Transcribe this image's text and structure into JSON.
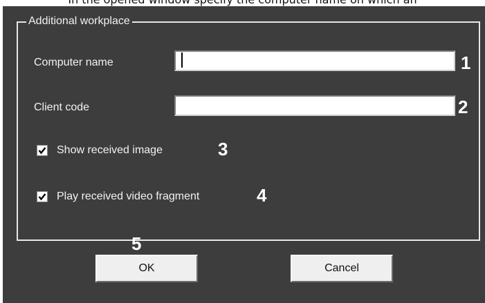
{
  "caption": "In the opened window specify the computer name on which an",
  "dialog": {
    "group_title": "Additional workplace",
    "fields": {
      "computer_name": {
        "label": "Computer name",
        "value": "",
        "marker": "1"
      },
      "client_code": {
        "label": "Client code",
        "value": "",
        "marker": "2"
      }
    },
    "checkboxes": {
      "show_image": {
        "label": "Show received image",
        "checked": true,
        "marker": "3"
      },
      "play_video": {
        "label": "Play received video fragment",
        "checked": true,
        "marker": "4"
      }
    },
    "buttons": {
      "ok": {
        "label": "OK",
        "marker": "5"
      },
      "cancel": {
        "label": "Cancel"
      }
    }
  },
  "colors": {
    "dialog_background": "#3d3d3d",
    "label_text": "#f2f2f2",
    "marker_text": "#ffffff"
  }
}
